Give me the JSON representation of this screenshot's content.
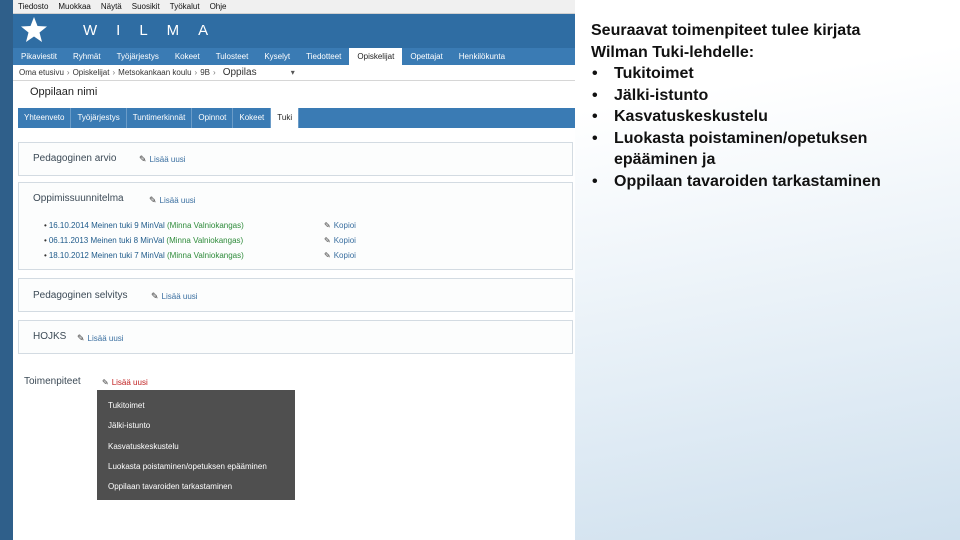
{
  "app": {
    "menubar": [
      "Tiedosto",
      "Muokkaa",
      "Näytä",
      "Suosikit",
      "Työkalut",
      "Ohje"
    ],
    "brand": "WILMA",
    "nav_tabs": [
      {
        "label": "Pikaviestit",
        "active": false
      },
      {
        "label": "Ryhmät",
        "active": false
      },
      {
        "label": "Työjärjestys",
        "active": false
      },
      {
        "label": "Kokeet",
        "active": false
      },
      {
        "label": "Tulosteet",
        "active": false
      },
      {
        "label": "Kyselyt",
        "active": false
      },
      {
        "label": "Tiedotteet",
        "active": false
      },
      {
        "label": "Opiskelijat",
        "active": true
      },
      {
        "label": "Opettajat",
        "active": false
      },
      {
        "label": "Henkilökunta",
        "active": false
      }
    ],
    "breadcrumb": [
      "Oma etusivu",
      "Opiskelijat",
      "Metsokankaan koulu",
      "9B"
    ],
    "student_select": "Oppilas",
    "student_name": "Oppilaan nimi",
    "sub_tabs": [
      {
        "label": "Yhteenveto",
        "active": false
      },
      {
        "label": "Työjärjestys",
        "active": false
      },
      {
        "label": "Tuntimerkinnät",
        "active": false
      },
      {
        "label": "Opinnot",
        "active": false
      },
      {
        "label": "Kokeet",
        "active": false
      },
      {
        "label": "Tuki",
        "active": true
      }
    ],
    "add_new": "Lisää uusi",
    "copy": "Kopioi",
    "sections": {
      "pedagogical_assessment": "Pedagoginen arvio",
      "learning_plan": "Oppimissuunnitelma",
      "pedagogical_statement": "Pedagoginen selvitys",
      "hojks": "HOJKS",
      "measures": "Toimenpiteet"
    },
    "plans": [
      {
        "date": "16.10.2014",
        "title": "Meinen tuki 9 MinVal",
        "who": "(Minna Valniokangas)"
      },
      {
        "date": "06.11.2013",
        "title": "Meinen tuki 8 MinVal",
        "who": "(Minna Valniokangas)"
      },
      {
        "date": "18.10.2012",
        "title": "Meinen tuki 7 MinVal",
        "who": "(Minna Valniokangas)"
      }
    ],
    "measure_options": [
      "Tukitoimet",
      "Jälki-istunto",
      "Kasvatuskeskustelu",
      "Luokasta poistaminen/opetuksen epääminen",
      "Oppilaan tavaroiden tarkastaminen"
    ]
  },
  "slide": {
    "intro_line1": "Seuraavat toimenpiteet tulee kirjata",
    "intro_line2": "Wilman Tuki-lehdelle:",
    "bullets": [
      "Tukitoimet",
      "Jälki-istunto",
      "Kasvatuskeskustelu",
      "Luokasta poistaminen/opetuksen epääminen ja",
      "Oppilaan tavaroiden tarkastaminen"
    ]
  },
  "colors": {
    "header_blue": "#2f6da3",
    "nav_blue": "#3a7bb4",
    "dropdown_gray": "#4f4f4f",
    "link_green": "#2e8b3a",
    "add_red": "#c02020"
  }
}
